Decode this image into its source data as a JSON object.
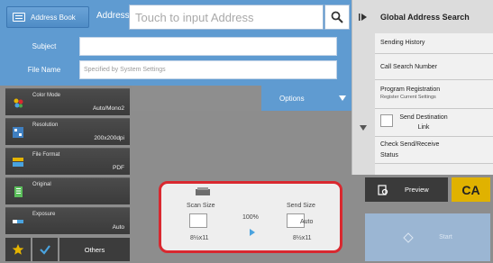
{
  "header": {
    "address_book_label": "Address Book",
    "address_label": "Address",
    "address_placeholder": "Touch to input Address"
  },
  "form": {
    "subject_label": "Subject",
    "subject_value": "",
    "filename_label": "File Name",
    "filename_placeholder": "Specified by System Settings"
  },
  "options_label": "Options",
  "settings": [
    {
      "label": "Color Mode",
      "value": "Auto/Mono2",
      "icon": "color-mode-icon"
    },
    {
      "label": "Resolution",
      "value": "200x200dpi",
      "icon": "resolution-icon"
    },
    {
      "label": "File Format",
      "value": "PDF",
      "icon": "file-format-icon"
    },
    {
      "label": "Original",
      "value": "",
      "icon": "original-icon"
    },
    {
      "label": "Exposure",
      "value": "Auto",
      "icon": "exposure-icon"
    }
  ],
  "bottom_left": {
    "others_label": "Others"
  },
  "preview_card": {
    "scan_size_label": "Scan Size",
    "scan_size_value": "8½x11",
    "ratio": "100%",
    "send_size_label": "Send Size",
    "send_auto": "Auto",
    "send_size_value": "8½x11"
  },
  "right_panel": {
    "title": "Global Address Search",
    "items": [
      {
        "label": "Sending History"
      },
      {
        "label": "Call Search Number"
      },
      {
        "label": "Program Registration",
        "sub": "Register Current Settings"
      },
      {
        "label": "Send Destination Link"
      },
      {
        "label": "Check Send/Receive Status"
      }
    ]
  },
  "actions": {
    "preview_label": "Preview",
    "ca_label": "CA",
    "start_label": "Start"
  },
  "colors": {
    "accent_blue": "#5f9bd1",
    "highlight_red": "#d9282f",
    "ca_yellow": "#e0b200"
  }
}
